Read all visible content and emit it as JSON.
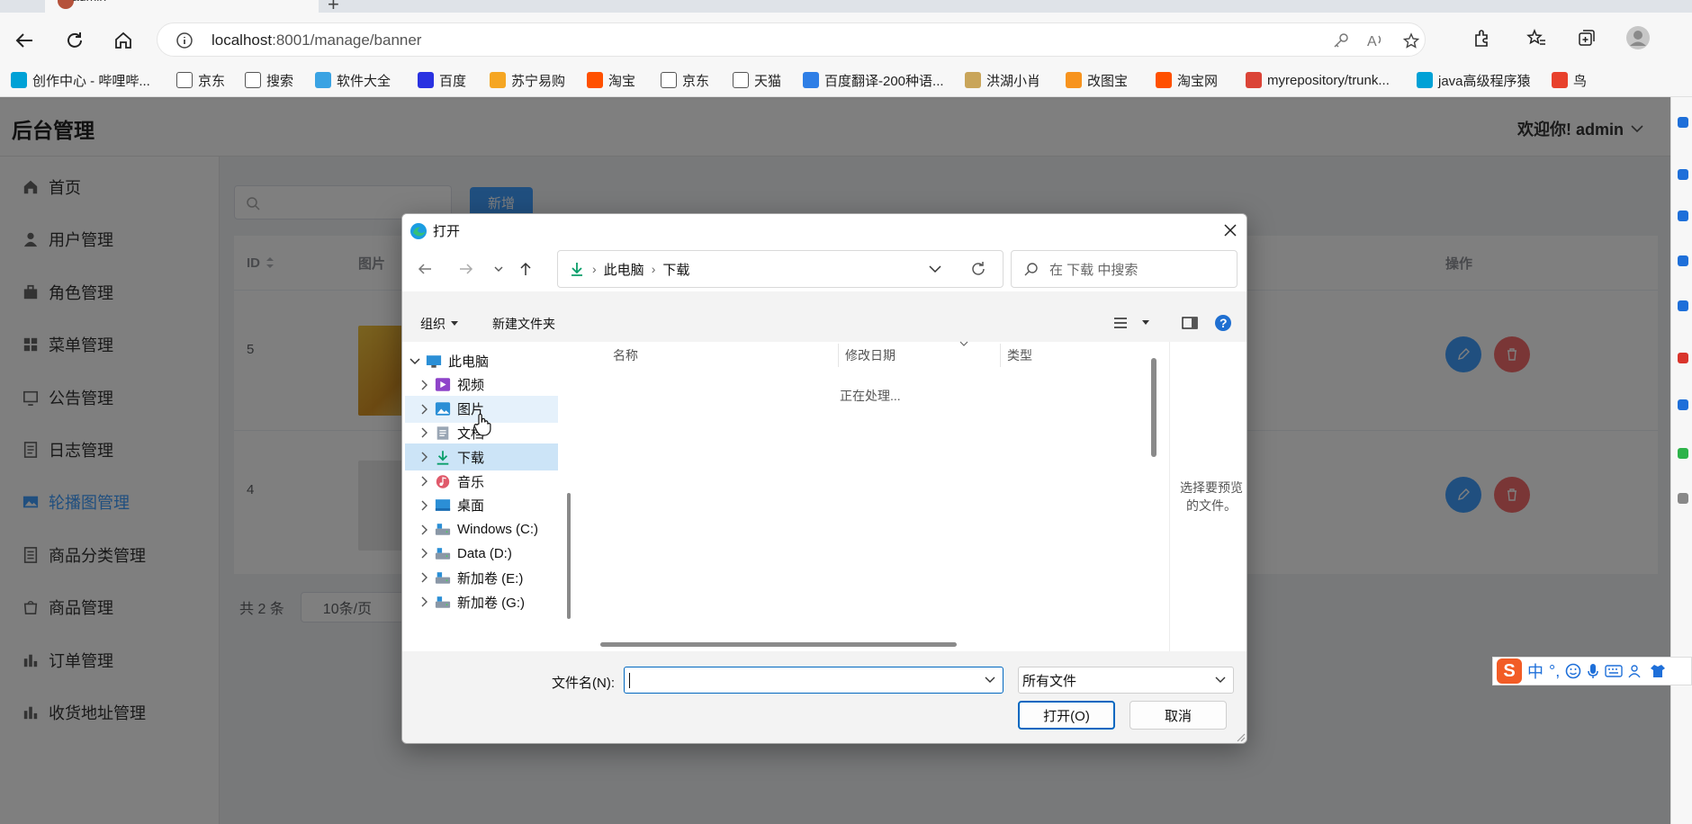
{
  "browser": {
    "tab_title": "admin",
    "url_host": "localhost",
    "url_rest": ":8001/manage/banner",
    "bookmarks": [
      {
        "label": "创作中心 - 哔哩哔...",
        "color": "#00a1d6"
      },
      {
        "label": "京东",
        "color": "#ffffff"
      },
      {
        "label": "搜索",
        "color": "#ffffff"
      },
      {
        "label": "软件大全",
        "color": "#3aa3e3"
      },
      {
        "label": "百度",
        "color": "#2932e1"
      },
      {
        "label": "苏宁易购",
        "color": "#f5a623"
      },
      {
        "label": "淘宝",
        "color": "#ff5000"
      },
      {
        "label": "京东",
        "color": "#ffffff"
      },
      {
        "label": "天猫",
        "color": "#ffffff"
      },
      {
        "label": "百度翻译-200种语...",
        "color": "#2f7fe6"
      },
      {
        "label": "洪湖小肖",
        "color": "#c9a55a"
      },
      {
        "label": "改图宝",
        "color": "#f7931e"
      },
      {
        "label": "淘宝网",
        "color": "#ff5000"
      },
      {
        "label": "myrepository/trunk...",
        "color": "#db4437"
      },
      {
        "label": "java高级程序猿",
        "color": "#00a1d6"
      },
      {
        "label": "鸟",
        "color": "#e8412c"
      }
    ]
  },
  "app": {
    "title": "后台管理",
    "welcome": "欢迎你! admin",
    "menu": [
      {
        "label": "首页",
        "icon": "home-icon"
      },
      {
        "label": "用户管理",
        "icon": "user-icon"
      },
      {
        "label": "角色管理",
        "icon": "briefcase-icon"
      },
      {
        "label": "菜单管理",
        "icon": "grid-icon"
      },
      {
        "label": "公告管理",
        "icon": "notice-icon"
      },
      {
        "label": "日志管理",
        "icon": "log-icon"
      },
      {
        "label": "轮播图管理",
        "icon": "image-icon"
      },
      {
        "label": "商品分类管理",
        "icon": "category-icon"
      },
      {
        "label": "商品管理",
        "icon": "goods-icon"
      },
      {
        "label": "订单管理",
        "icon": "chart-icon"
      },
      {
        "label": "收货地址管理",
        "icon": "chart-icon"
      }
    ],
    "add_button": "新增",
    "table": {
      "headers": {
        "id": "ID",
        "image": "图片",
        "actions": "操作"
      },
      "rows": [
        {
          "id": "5"
        },
        {
          "id": "4"
        }
      ]
    },
    "pagination": {
      "total": "共 2 条",
      "page_size": "10条/页"
    }
  },
  "dialog": {
    "title": "打开",
    "breadcrumb": [
      "此电脑",
      "下载"
    ],
    "search_placeholder": "在 下载 中搜索",
    "organize": "组织",
    "new_folder": "新建文件夹",
    "tree": [
      {
        "label": "此电脑",
        "icon": "computer-icon"
      },
      {
        "label": "视频",
        "icon": "video-icon"
      },
      {
        "label": "图片",
        "icon": "pictures-icon"
      },
      {
        "label": "文档",
        "icon": "documents-icon"
      },
      {
        "label": "下载",
        "icon": "download-icon"
      },
      {
        "label": "音乐",
        "icon": "music-icon"
      },
      {
        "label": "桌面",
        "icon": "desktop-icon"
      },
      {
        "label": "Windows (C:)",
        "icon": "drive-icon"
      },
      {
        "label": "Data (D:)",
        "icon": "drive-icon"
      },
      {
        "label": "新加卷 (E:)",
        "icon": "drive-icon"
      },
      {
        "label": "新加卷 (G:)",
        "icon": "drive-icon"
      }
    ],
    "columns": {
      "name": "名称",
      "modified": "修改日期",
      "type": "类型"
    },
    "status": "正在处理...",
    "preview_hint": "选择要预览的文件。",
    "filename_label": "文件名(N):",
    "filename_value": "",
    "filetype": "所有文件",
    "open_button": "打开(O)",
    "cancel_button": "取消"
  },
  "ime": {
    "lang": "中",
    "punct": "°,"
  }
}
